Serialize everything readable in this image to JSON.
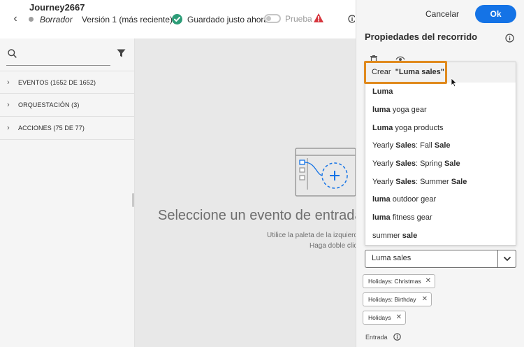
{
  "header": {
    "journey_name": "Journey2667",
    "status": "Borrador",
    "version": "Versión 1 (más reciente)",
    "save_status": "Guardado justo ahora",
    "test_label": "Prueba",
    "test_enabled": false
  },
  "palette": {
    "search_placeholder": "",
    "categories": [
      {
        "label": "EVENTOS (1652 DE 1652)"
      },
      {
        "label": "ORQUESTACIÓN (3)"
      },
      {
        "label": "ACCIONES (75 DE 77)"
      }
    ]
  },
  "canvas": {
    "empty_title": "Seleccione un evento de entrada",
    "empty_hint_1": "Utilice la paleta de la izquierda",
    "empty_hint_2": "Haga doble clic"
  },
  "panel": {
    "cancel_label": "Cancelar",
    "ok_label": "Ok",
    "title": "Propiedades del recorrido",
    "entry_label": "Entrada"
  },
  "dropdown": {
    "create_prefix": "Crear",
    "create_value": "\"Luma sales\"",
    "options": [
      {
        "parts": [
          {
            "t": "Luma",
            "b": true
          }
        ]
      },
      {
        "parts": [
          {
            "t": "luma",
            "b": true
          },
          {
            "t": " yoga gear",
            "b": false
          }
        ]
      },
      {
        "parts": [
          {
            "t": "Luma",
            "b": true
          },
          {
            "t": " yoga products",
            "b": false
          }
        ]
      },
      {
        "parts": [
          {
            "t": "Yearly ",
            "b": false
          },
          {
            "t": "Sales",
            "b": true
          },
          {
            "t": ": Fall ",
            "b": false
          },
          {
            "t": "Sale",
            "b": true
          }
        ]
      },
      {
        "parts": [
          {
            "t": "Yearly ",
            "b": false
          },
          {
            "t": "Sales",
            "b": true
          },
          {
            "t": ": Spring ",
            "b": false
          },
          {
            "t": "Sale",
            "b": true
          }
        ]
      },
      {
        "parts": [
          {
            "t": "Yearly ",
            "b": false
          },
          {
            "t": "Sales",
            "b": true
          },
          {
            "t": ": Summer ",
            "b": false
          },
          {
            "t": "Sale",
            "b": true
          }
        ]
      },
      {
        "parts": [
          {
            "t": "luma",
            "b": true
          },
          {
            "t": " outdoor gear",
            "b": false
          }
        ]
      },
      {
        "parts": [
          {
            "t": "luma",
            "b": true
          },
          {
            "t": " fitness gear",
            "b": false
          }
        ]
      },
      {
        "parts": [
          {
            "t": "summer ",
            "b": false
          },
          {
            "t": "sale",
            "b": true
          }
        ]
      }
    ]
  },
  "combo": {
    "value": "Luma sales"
  },
  "tags": [
    {
      "label": "Holidays: Christmas"
    },
    {
      "label": "Holidays: Birthday"
    },
    {
      "label": "Holidays"
    }
  ],
  "colors": {
    "accent": "#1473e6",
    "highlight": "#e08a1e",
    "success": "#2d9d78",
    "alert": "#d7373f"
  },
  "icons": [
    "back-arrow-icon",
    "check-circle-icon",
    "alert-icon",
    "info-icon",
    "search-icon",
    "filter-icon",
    "chevron-right-icon",
    "trash-icon",
    "eye-icon",
    "chevron-down-icon",
    "close-icon",
    "add-circle-icon",
    "cursor-icon"
  ]
}
